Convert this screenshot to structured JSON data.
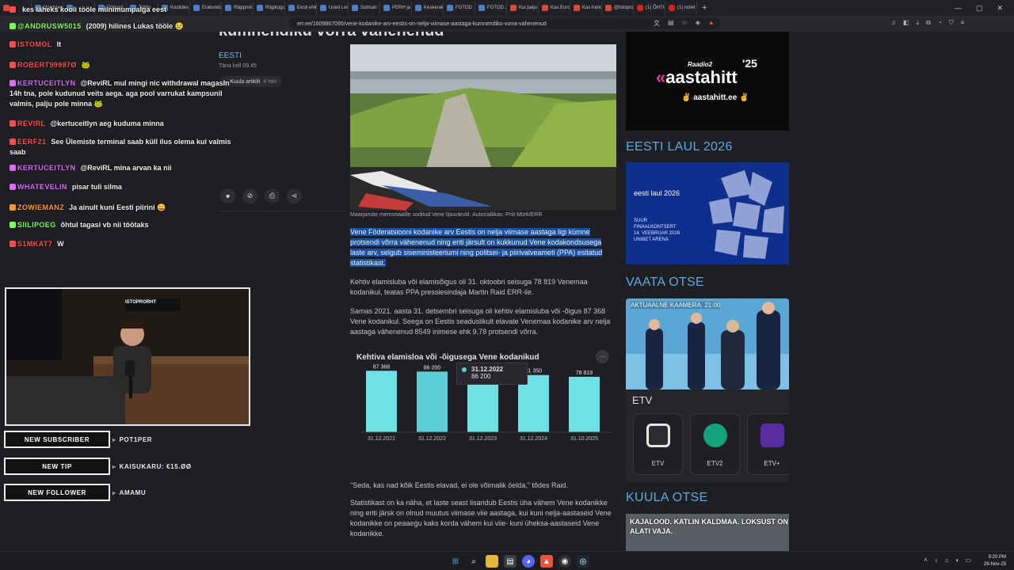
{
  "browser": {
    "tabs": [
      {
        "title": "",
        "type": "red"
      },
      {
        "title": "Nordsten",
        "type": "doc"
      },
      {
        "title": "",
        "type": "doc"
      },
      {
        "title": "Pöörast",
        "type": "doc"
      },
      {
        "title": "Tahtis",
        "type": "doc"
      },
      {
        "title": "Koolides",
        "type": "doc"
      },
      {
        "title": "Erakonda",
        "type": "doc"
      },
      {
        "title": "Riigiprok",
        "type": "doc"
      },
      {
        "title": "Riigikogu",
        "type": "doc"
      },
      {
        "title": "Eesti ehit",
        "type": "doc"
      },
      {
        "title": "Uued Lec",
        "type": "doc"
      },
      {
        "title": "Solman:",
        "type": "doc"
      },
      {
        "title": "PERH ja",
        "type": "doc"
      },
      {
        "title": "Keskerak",
        "type": "doc"
      },
      {
        "title": "FOTOD",
        "type": "doc"
      },
      {
        "title": "FOTOD J",
        "type": "doc"
      },
      {
        "title": "Kui palju",
        "type": "red"
      },
      {
        "title": "Kas Euroo",
        "type": "red"
      },
      {
        "title": "Kas harid",
        "type": "red"
      },
      {
        "title": "@tstopro",
        "type": "red"
      },
      {
        "title": "(1) ÕHTU",
        "type": "yt"
      },
      {
        "title": "(1) rebet",
        "type": "yt"
      }
    ],
    "url": "err.ee/1609867095/vene-kodanike-arv-eestis-on-nelja-viimase-aastaga-kumnendiku-vorra-vahenenud"
  },
  "article": {
    "title": "kümnendiku võrra vähenenud",
    "category": "EESTI",
    "time": "Täna kell 09.45",
    "read_label": "Kuula artiklit",
    "read_time": "4 min",
    "photo_caption": "Maarjamäe memoriaalile soditud Vene lipuvärvid. Autor/allikas: Priit Mürk/ERR",
    "lead": "Vene Föderatsiooni kodanike arv Eestis on nelja viimase aastaga ligi kümne protsendi võrra vähenenud ning eriti järsult on kukkunud Vene kodakondsusega laste arv, selgub siseministeeriumi ning politsei- ja piirivalveameti (PPA) esitatud statistikast.",
    "p1": "Kehtiv elamisluba või elamisõigus oli 31. oktoobri seisuga 78 819 Venemaa kodanikul, teatas PPA pressiesindaja Martin Raid ERR-ile.",
    "p2": "Samas 2021. aasta 31. detsembri seisuga oli kehtiv elamisluba või -õigus 87 368 Vene kodanikul. Seega on Eestis seaduslikult elavate Venemaa kodanike arv nelja aastaga vähenenud 8549 inimese ehk 9,78 protsendi võrra.",
    "p3": "\"Seda, kas nad kõik Eestis elavad, ei ole võimalik öelda,\" tõdes Raid.",
    "p4": "Statistikast on ka näha, et laste seast lisandub Eestis üha vähem Vene kodanikke ning eriti järsk on olnud muutus viimase viie aastaga, kui kuni nelja-aastaseid Vene kodanikke on peaaegu kaks korda vähem kui viie- kuni üheksa-aastaseid Vene kodanikke.",
    "more_label": "···"
  },
  "chart_data": {
    "type": "bar",
    "title": "Kehtiva elamisloa või -õigusega Vene kodanikud",
    "categories": [
      "31.12.2021",
      "31.12.2022",
      "31.12.2023",
      "31.12.2024",
      "31.10.2025"
    ],
    "values": [
      87368,
      86200,
      79000,
      81350,
      78819
    ],
    "value_labels": [
      "87 368",
      "86 200",
      "",
      "81 350",
      "78 819"
    ],
    "colors": {
      "bar": "#6ee0e6",
      "bar_hover": "#5ccfd6"
    },
    "tooltip": {
      "date": "31.12.2022",
      "value": "86 200"
    },
    "xlabel": "",
    "ylabel": "",
    "grid": false
  },
  "share_icons": [
    "heart-icon",
    "link-icon",
    "print-icon",
    "share-icon"
  ],
  "sidebar": {
    "radio_ad": {
      "brand": "Raadio2",
      "name": "aastahitt",
      "year": "'25",
      "url": "aastahitt.ee"
    },
    "eesti_laul_title": "EESTI LAUL 2026",
    "eesti_laul_ad": {
      "logo": "eesti laul 2026",
      "line1": "SUUR FINAALKONTSERT",
      "line2": "14. VEEBRUAR 2026",
      "line3": "UNIBET ARENA"
    },
    "vaata_title": "VAATA OTSE",
    "tv_tag": "AKTUAALNE KAAMERA. 21:00",
    "etv_label": "ETV",
    "channels": [
      {
        "name": "ETV",
        "color": "#e6e6e6"
      },
      {
        "name": "ETV2",
        "color": "#12a37a"
      },
      {
        "name": "ETV+",
        "color": "#5a2ea3"
      }
    ],
    "kuula_title": "KUULA OTSE",
    "radio_live_text": "KAJALOOD. KATLIN KALDMAA. LOKSUST ON ALATI VAJA."
  },
  "stream": {
    "chat": [
      {
        "name": "",
        "text": "kes läheks kooli tööle miinimumpalga eest",
        "color": "#ff4d4d"
      },
      {
        "name": "@ANDRUSW5015",
        "text": "(2009) hilines Lukas tööle 😢",
        "color": "#7fff5a"
      },
      {
        "name": "ISTOMOL",
        "text": "lt",
        "color": "#ff4d4d"
      },
      {
        "name": "ROBERT99987Ø",
        "text": "🐸",
        "color": "#ff4d4d"
      },
      {
        "name": "KERTUCEITLYN",
        "text": "@ReviRL mul mingi nic withdrawal magasin 14h tna, pole kudunud veits aega. aga pool varrukat kampsunil valmis, palju pole minna 🐸",
        "color": "#d96bff"
      },
      {
        "name": "REVIRL",
        "text": "@kertuceitlyn aeg kuduma minna",
        "color": "#ff4d4d"
      },
      {
        "name": "EERF21",
        "text": "See Ülemiste terminal saab küll ilus olema kui valmis saab",
        "color": "#ff4d4d"
      },
      {
        "name": "KERTUCEITLYN",
        "text": "@ReviRL mina arvan ka nii",
        "color": "#d96bff"
      },
      {
        "name": "WHATEVELIN",
        "text": "pisar tuli silma",
        "color": "#d96bff"
      },
      {
        "name": "ZOWIEMANZ",
        "text": "Ja ainult kuni Eesti piirini 😄",
        "color": "#ff9a3c"
      },
      {
        "name": "SIILIPOEG",
        "text": "õhtul tagasi vb nii töötaks",
        "color": "#7fff5a"
      },
      {
        "name": "S1MKAT7",
        "text": "W",
        "color": "#ff4d4d"
      }
    ],
    "alerts": [
      {
        "label": "NEW SUBSCRIBER",
        "value": "POT1PER"
      },
      {
        "label": "NEW TIP",
        "value": "KAISUKARU: €15.ØØ"
      },
      {
        "label": "NEW FOLLOWER",
        "value": "AMAMU"
      }
    ],
    "cam_logo": "ISTOPRORHT"
  },
  "taskbar": {
    "time": "9:20 PM",
    "date": "26-Nov-25"
  }
}
